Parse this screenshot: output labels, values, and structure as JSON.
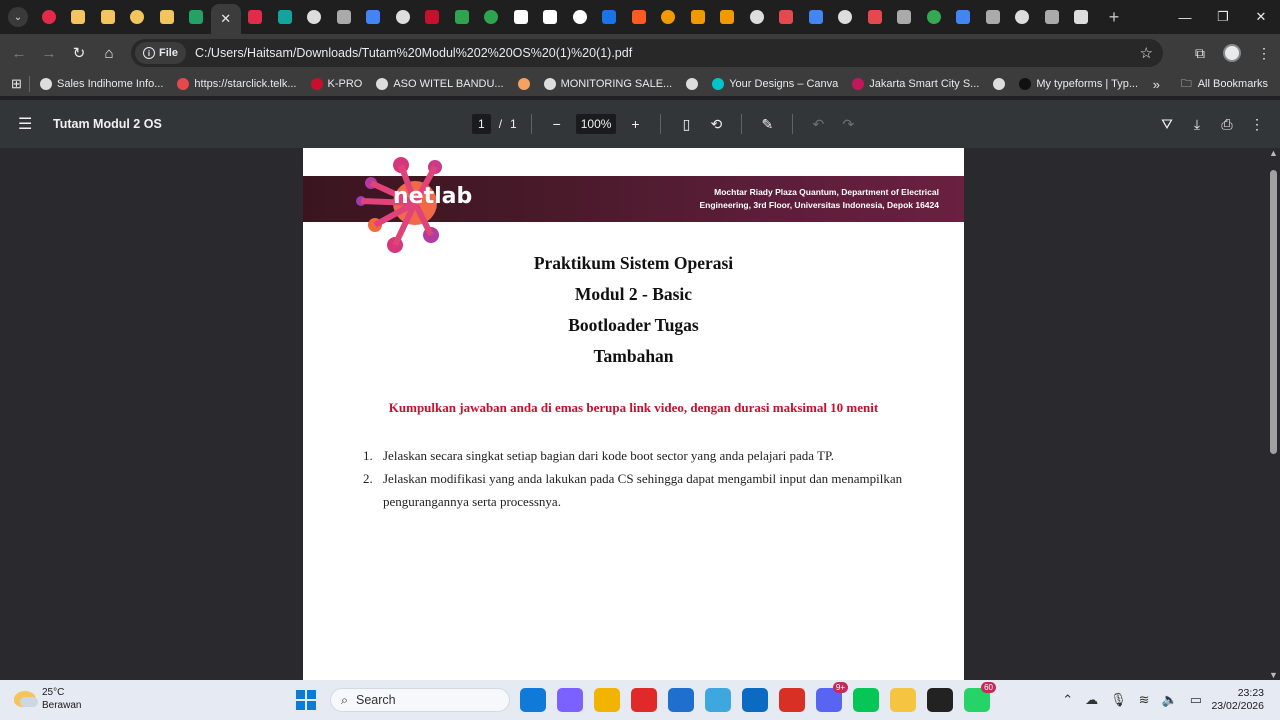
{
  "browser": {
    "active_tab_close": "✕",
    "new_tab": "+",
    "tab_favicon_colors": [
      "#e22a4a",
      "#f4c55c",
      "#f4c55c",
      "#f4c55c",
      "#f4c55c",
      "#21a366",
      "ACTIVE",
      "#e22a4a",
      "#12a59d",
      "#dddddd",
      "#aaaaaa",
      "#4285f4",
      "#dddddd",
      "#c8102e",
      "#2ea44f",
      "#2ea44f",
      "#ffffff",
      "#ffffff",
      "#ffffff",
      "#1a73e8",
      "#ff5a1f",
      "#f29900",
      "#f29900",
      "#f29900",
      "#dddddd",
      "#e5484d",
      "#4285f4",
      "#dddddd",
      "#e5484d",
      "#aaaaaa",
      "#34a853",
      "#4285f4",
      "#aaaaaa",
      "#dddddd",
      "#aaaaaa",
      "#dddddd"
    ],
    "address": {
      "scheme_chip": "File",
      "url": "C:/Users/Haitsam/Downloads/Tutam%20Modul%202%20OS%20(1)%20(1).pdf"
    }
  },
  "bookmarks": {
    "items": [
      {
        "label": "Sales Indihome Info...",
        "color": "#dddddd"
      },
      {
        "label": "https://starclick.telk...",
        "color": "#e5484d"
      },
      {
        "label": "K-PRO",
        "color": "#c8102e"
      },
      {
        "label": "ASO WITEL BANDU...",
        "color": "#dddddd"
      },
      {
        "label": "",
        "color": "#f4a261"
      },
      {
        "label": "MONITORING SALE...",
        "color": "#dddddd"
      },
      {
        "label": "",
        "color": "#dddddd"
      },
      {
        "label": "Your Designs – Canva",
        "color": "#00c4cc"
      },
      {
        "label": "Jakarta Smart City S...",
        "color": "#c2185b"
      },
      {
        "label": "",
        "color": "#dddddd"
      },
      {
        "label": "My typeforms | Typ...",
        "color": "#111111"
      }
    ],
    "more": "»",
    "all_bookmarks": "All Bookmarks"
  },
  "pdf_toolbar": {
    "title": "Tutam Modul 2 OS",
    "page_current": "1",
    "page_sep": "/",
    "page_total": "1",
    "zoom": "100%"
  },
  "document": {
    "banner_line1": "Mochtar Riady Plaza Quantum, Department of Electrical",
    "banner_line2": "Engineering, 3rd Floor, Universitas Indonesia, Depok 16424",
    "logo_text": "netlab",
    "titles": [
      "Praktikum Sistem Operasi",
      "Modul 2 - Basic",
      "Bootloader Tugas",
      "Tambahan"
    ],
    "notice": "Kumpulkan jawaban anda di emas berupa link video, dengan durasi maksimal 10 menit",
    "questions": [
      {
        "num": "1.",
        "text": "Jelaskan secara singkat setiap bagian dari kode boot sector yang anda pelajari pada TP."
      },
      {
        "num": "2.",
        "text": "Jelaskan modifikasi yang anda lakukan pada CS sehingga dapat mengambil input dan menampilkan pengurangannya serta processnya."
      }
    ]
  },
  "taskbar": {
    "temperature": "25°C",
    "weather": "Berawan",
    "search_placeholder": "Search",
    "app_colors": [
      "#0f7ad8",
      "#7b61ff",
      "#f3b400",
      "#e02a2a",
      "#1f6fcf",
      "#3fa7e0",
      "#0b6ac2",
      "#d93025",
      "#5865f2",
      "#06c755",
      "#f5c542",
      "#222222",
      "#25d366"
    ],
    "discord_badge": "9+",
    "whatsapp_badge": "60",
    "time": "23:23",
    "date": "23/02/2026"
  }
}
